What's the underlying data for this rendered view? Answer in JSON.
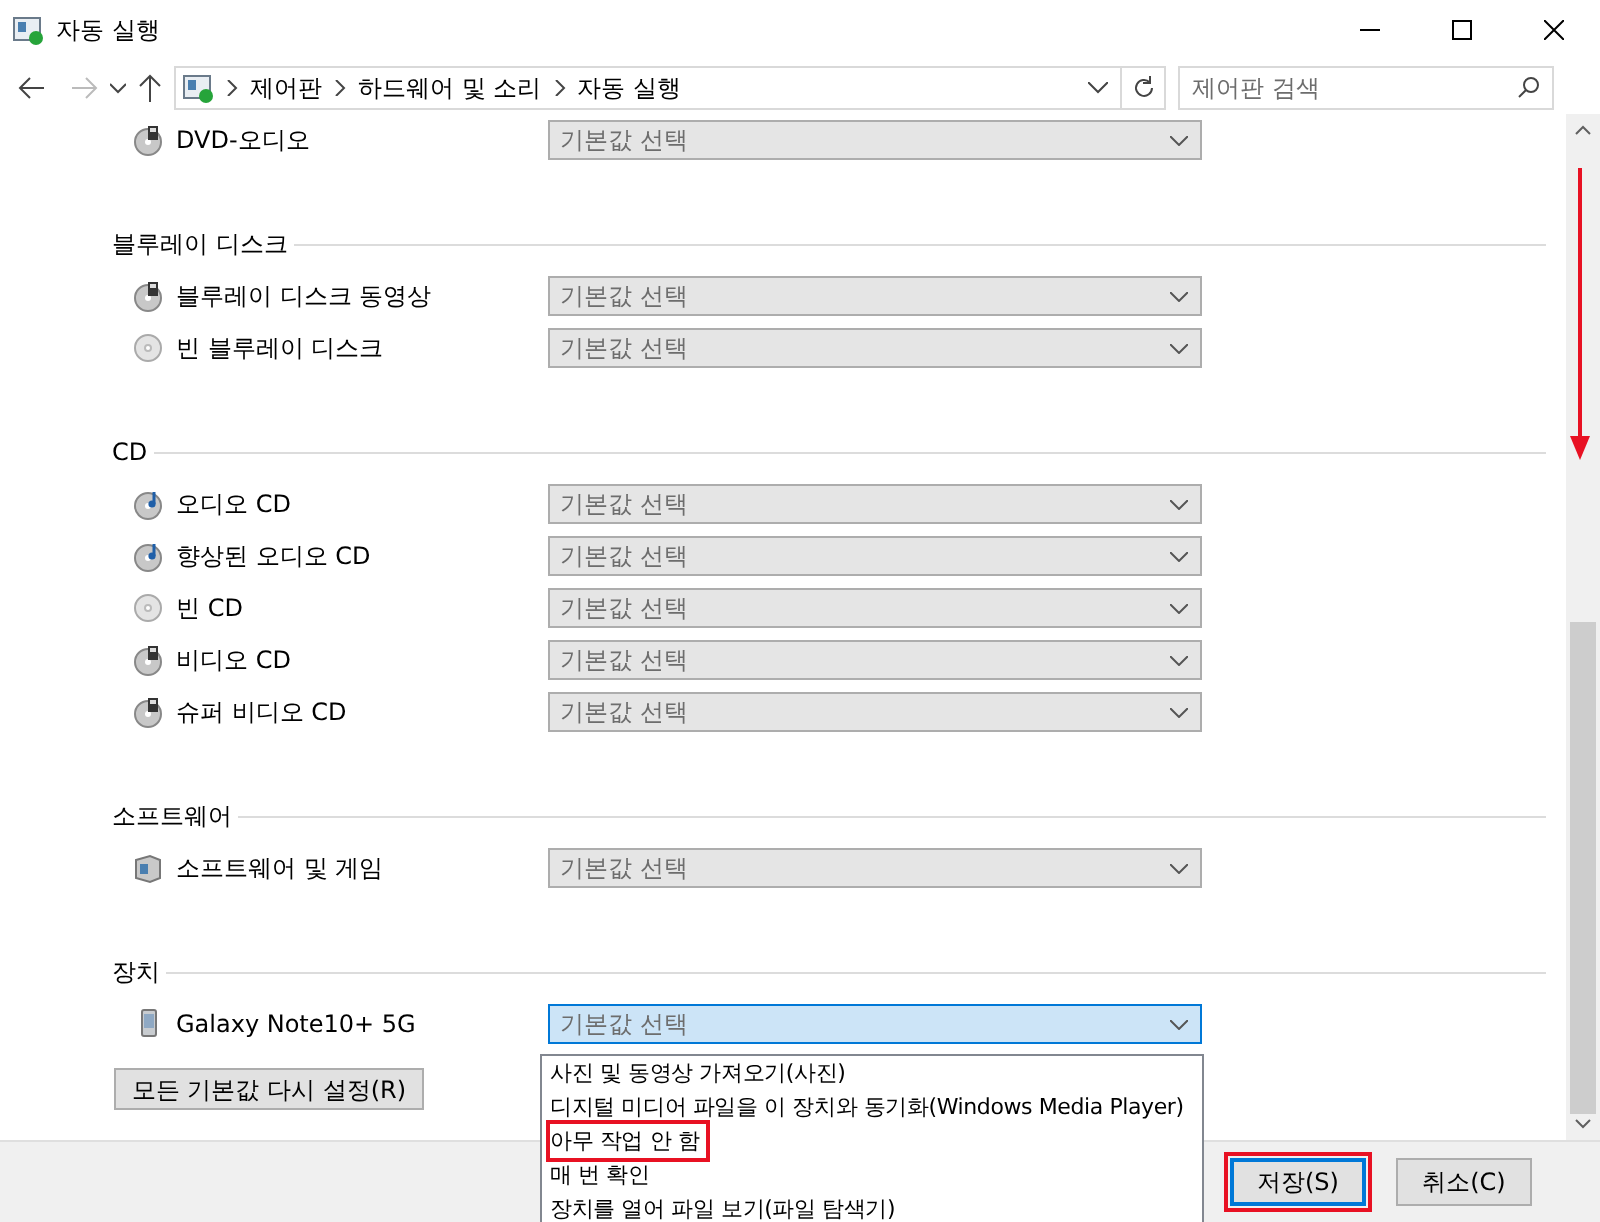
{
  "window": {
    "title": "자동 실행"
  },
  "address_bar": {
    "breadcrumb": [
      "제어판",
      "하드웨어 및 소리",
      "자동 실행"
    ]
  },
  "search": {
    "placeholder": "제어판 검색"
  },
  "sections": [
    {
      "items": [
        {
          "kind": "video-disc",
          "label": "DVD-오디오",
          "value": "기본값 선택",
          "expanded": false
        }
      ]
    },
    {
      "heading": "블루레이 디스크",
      "items": [
        {
          "kind": "video-disc",
          "label": "블루레이 디스크 동영상",
          "value": "기본값 선택",
          "expanded": false
        },
        {
          "kind": "blank-disc",
          "label": "빈 블루레이 디스크",
          "value": "기본값 선택",
          "expanded": false
        }
      ]
    },
    {
      "heading": "CD",
      "items": [
        {
          "kind": "music-disc",
          "label": "오디오 CD",
          "value": "기본값 선택",
          "expanded": false
        },
        {
          "kind": "music-disc",
          "label": "향상된 오디오 CD",
          "value": "기본값 선택",
          "expanded": false
        },
        {
          "kind": "blank-disc",
          "label": "빈 CD",
          "value": "기본값 선택",
          "expanded": false
        },
        {
          "kind": "video-disc",
          "label": "비디오 CD",
          "value": "기본값 선택",
          "expanded": false
        },
        {
          "kind": "video-disc",
          "label": "슈퍼 비디오 CD",
          "value": "기본값 선택",
          "expanded": false
        }
      ]
    },
    {
      "heading": "소프트웨어",
      "items": [
        {
          "kind": "software",
          "label": "소프트웨어 및 게임",
          "value": "기본값 선택",
          "expanded": false
        }
      ]
    },
    {
      "heading": "장치",
      "items": [
        {
          "kind": "phone",
          "label": "Galaxy Note10+ 5G",
          "value": "기본값 선택",
          "expanded": true
        }
      ]
    }
  ],
  "reset_button": "모든 기본값 다시 설정(R)",
  "dropdown_options": [
    {
      "label": "사진 및 동영상 가져오기(사진)",
      "highlighted": false
    },
    {
      "label": "디지털 미디어 파일을 이 장치와 동기화(Windows Media Player)",
      "highlighted": false
    },
    {
      "label": "아무 작업 안 함",
      "highlighted": true
    },
    {
      "label": "매 번 확인",
      "highlighted": false
    },
    {
      "label": "장치를 열어 파일 보기(파일 탐색기)",
      "highlighted": false
    }
  ],
  "buttons": [
    {
      "label": "저장(S)",
      "default": true,
      "highlighted": true
    },
    {
      "label": "취소(C)",
      "default": false,
      "highlighted": false
    }
  ],
  "scroll_arrow": true
}
